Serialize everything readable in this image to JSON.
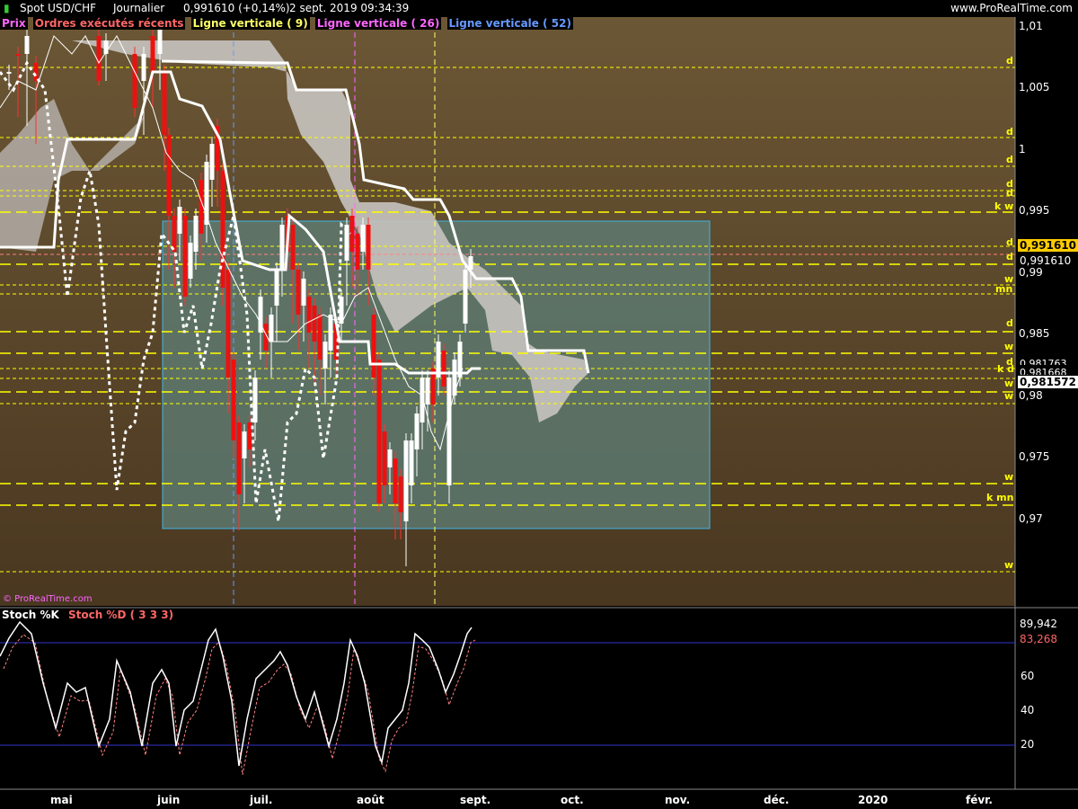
{
  "header": {
    "symbol": "Spot USD/CHF",
    "period": "Journalier",
    "quote": "0,991610 (+0,14%)",
    "datetime": "2 sept. 2019 09:34:39",
    "site": "www.ProRealTime.com"
  },
  "legend": [
    {
      "label": "Prix",
      "color": "#ff66ff"
    },
    {
      "label": "Ordres exécutés récents",
      "color": "#ff6666"
    },
    {
      "label": "Ligne verticale ( 9)",
      "color": "#ffff66"
    },
    {
      "label": "Ligne verticale ( 26)",
      "color": "#ff66ff"
    },
    {
      "label": "Ligne verticale ( 52)",
      "color": "#6699ff"
    }
  ],
  "watermark": "© ProRealTime.com",
  "price_axis": [
    "1,01",
    "1,005",
    "1",
    "0,995",
    "0,99",
    "0,985",
    "0,98",
    "0,975",
    "0,97"
  ],
  "price_tags": {
    "last": "0,991610",
    "last_small": "0,991610",
    "t1": "0,981763",
    "t2": "0,981668",
    "t3": "0,981572"
  },
  "level_marks": [
    "d",
    "d",
    "d",
    "d",
    "d",
    "k w",
    "d",
    "d",
    "w",
    "mn",
    "d",
    "w",
    "d",
    "k d",
    "w",
    "w",
    "w",
    "k mn",
    "w"
  ],
  "stoch": {
    "label_k": "Stoch %K",
    "label_d": "Stoch %D ( 3 3 3)",
    "k_value": "89,942",
    "d_value": "83,268",
    "axis": [
      "60",
      "40",
      "20"
    ]
  },
  "months": [
    "mai",
    "juin",
    "juil.",
    "août",
    "sept.",
    "oct.",
    "nov.",
    "déc.",
    "2020",
    "févr."
  ],
  "colors": {
    "background": "#5a4428",
    "box_fill": "#5f7b74",
    "box_border": "#3fb6e8",
    "level_line": "#ffff00",
    "candle_up": "#ffffff",
    "candle_down": "#ff2020",
    "cloud": "#c8c4c0"
  }
}
